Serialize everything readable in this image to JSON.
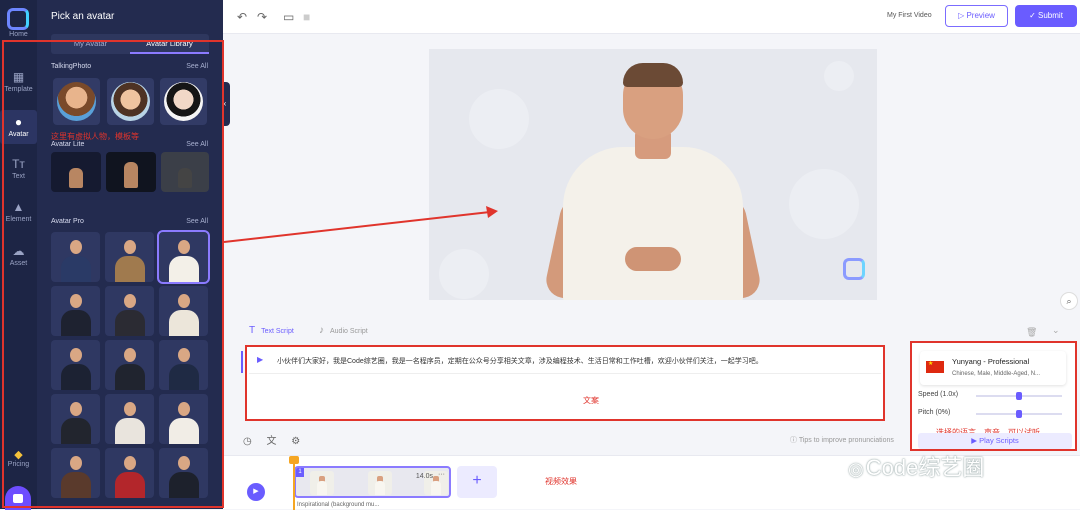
{
  "rail": {
    "home": "Home",
    "template": "Template",
    "avatar": "Avatar",
    "text": "Text",
    "element": "Element",
    "asset": "Asset",
    "pricing": "Pricing"
  },
  "panel": {
    "title": "Pick an avatar",
    "tabs": [
      "My Avatar",
      "Avatar Library"
    ],
    "active_tab": "Avatar Library",
    "sections": {
      "talking_photo": "TalkingPhoto",
      "avatar_lite": "Avatar Lite",
      "avatar_pro": "Avatar Pro",
      "see_all": "See All"
    }
  },
  "topbar": {
    "video_name": "My First Video",
    "preview": "Preview",
    "submit": "Submit"
  },
  "script": {
    "tab_text": "Text Script",
    "tab_audio": "Audio Script",
    "content": "小伙伴们大家好，我是Code综艺圈，我是一名程序员，定期在公众号分享相关文章，涉及编程技术、生活日常和工作吐槽，欢迎小伙伴们关注，一起学习吧。",
    "tips": "Tips to improve pronunciations"
  },
  "voice": {
    "name": "Yunyang - Professional",
    "meta": "Chinese, Male, Middle-Aged, N...",
    "speed_label": "Speed (1.0x)",
    "speed_value": 0.5,
    "pitch_label": "Pitch (0%)",
    "pitch_value": 0.5,
    "play": "Play Scripts"
  },
  "timeline": {
    "clip_index": "1",
    "duration": "14.0s",
    "clip_label": "Inspirational (background mu..."
  },
  "annotations": {
    "avatar_note": "这里有虚拟人物，模板等",
    "script_note": "文案",
    "voice_note": "选择的语言、声音，可以试听",
    "video_note": "视频效果",
    "watermark": "Code综艺圈"
  },
  "colors": {
    "accent": "#6a5cff",
    "panel": "#232b4f",
    "rail": "#1d2545",
    "annotation": "#e0342c"
  }
}
